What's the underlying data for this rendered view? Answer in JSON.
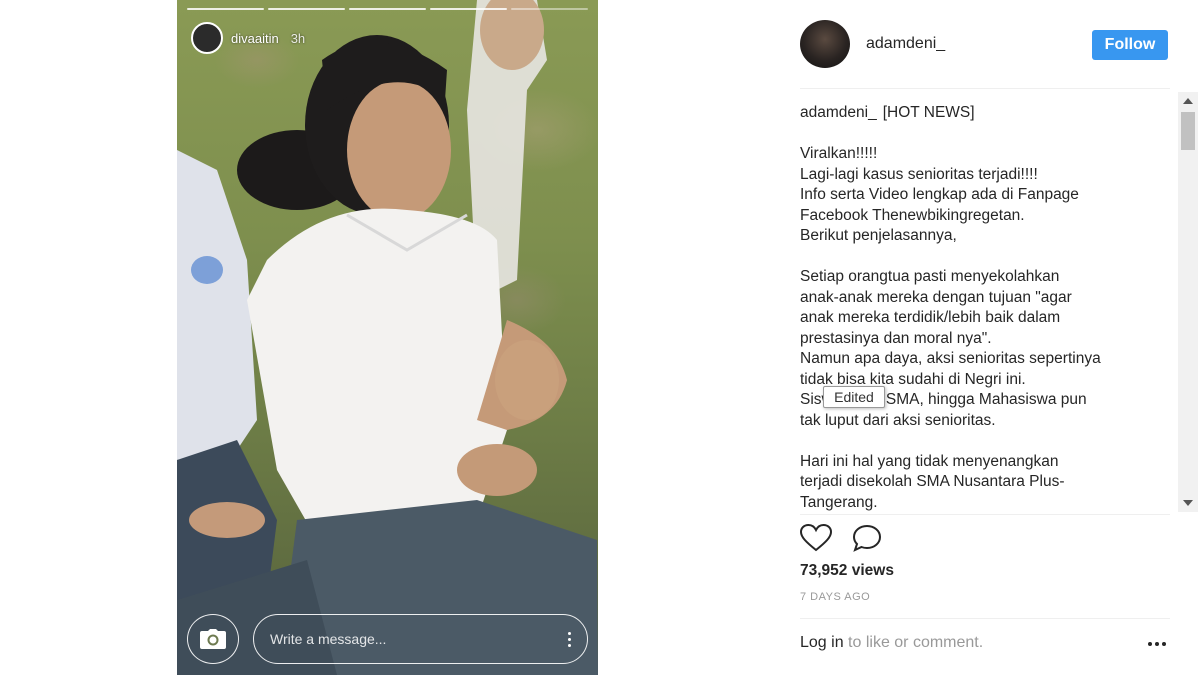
{
  "story": {
    "username": "divaaitin",
    "time_ago": "3h",
    "avatar_icon": "user-avatar",
    "camera_icon": "camera-icon",
    "message_placeholder": "Write a message...",
    "options_icon": "vertical-dots-icon"
  },
  "post": {
    "owner": "adamdeni_",
    "follow_label": "Follow",
    "caption_user": "adamdeni_",
    "caption_body": "[HOT NEWS]\n\nViralkan!!!!!\nLagi-lagi kasus senioritas terjadi!!!!\nInfo serta Video lengkap ada di Fanpage\nFacebook Thenewbikingregetan.\nBerikut penjelasannya,\n\nSetiap orangtua pasti menyekolahkan\nanak-anak mereka dengan tujuan \"agar\nanak mereka terdidik/lebih baik dalam\nprestasinya dan moral nya\".\nNamun apa daya, aksi senioritas sepertinya\ntidak bisa kita sudahi di Negri ini.\nSiswa SMP, SMA, hingga Mahasiswa pun\ntak luput dari aksi senioritas.\n\nHari ini hal yang tidak menyenangkan\nterjadi disekolah SMA Nusantara Plus-\nTangerang.\nDimana para junior dikumpulkan ditempat",
    "edited_tag": "Edited",
    "like_icon": "heart-icon",
    "comment_icon": "comment-icon",
    "views": "73,952 views",
    "date": "7 DAYS AGO",
    "login_link": "Log in",
    "login_rest": " to like or comment.",
    "more_icon": "more-options-icon"
  },
  "colors": {
    "follow_button": "#3897f0",
    "text_primary": "#262626",
    "text_secondary": "#999999"
  }
}
